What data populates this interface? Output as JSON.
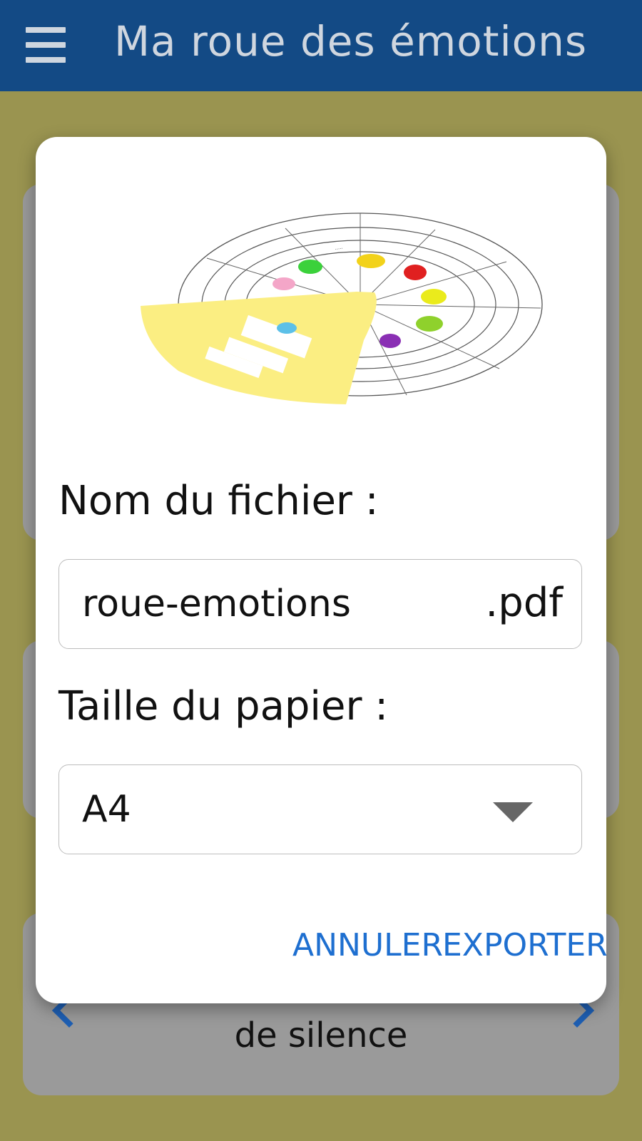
{
  "app": {
    "title": "Ma roue des émotions",
    "menu_icon": "hamburger-menu-icon"
  },
  "background": {
    "card_text": "de silence"
  },
  "dialog": {
    "preview_image": "emotion-wheel-preview",
    "filename_label": "Nom du fichier :",
    "filename_value": "roue-emotions",
    "filename_suffix": ".pdf",
    "paper_label": "Taille du papier :",
    "paper_value": "A4",
    "dropdown_icon": "dropdown-arrow-icon",
    "cancel_label": "ANNULER",
    "export_label": "EXPORTER"
  },
  "colors": {
    "appbar": "#134a85",
    "background": "#9a9450",
    "accent": "#1e6fd0"
  }
}
